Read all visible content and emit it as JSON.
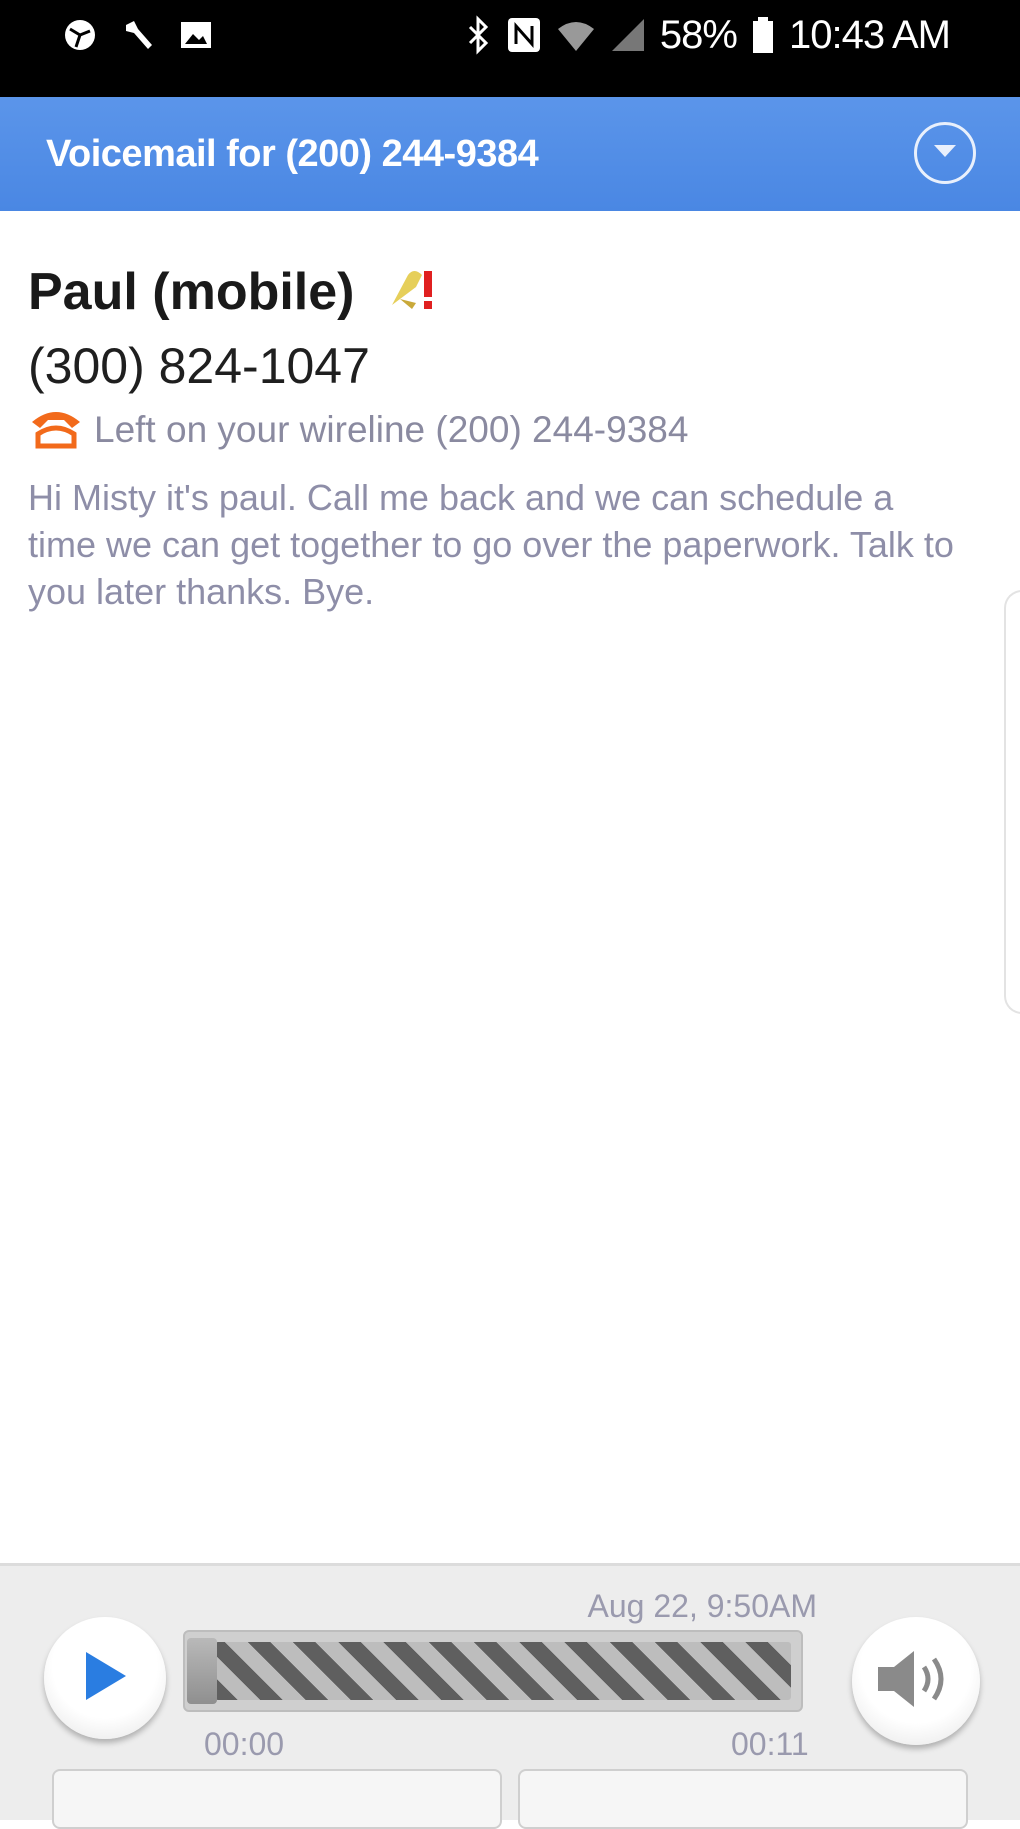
{
  "status_bar": {
    "battery": "58%",
    "time": "10:43 AM",
    "icons": [
      "vpn-icon",
      "wrench-icon",
      "image-icon",
      "bluetooth-icon",
      "nfc-icon",
      "wifi-icon",
      "signal-icon",
      "battery-icon"
    ]
  },
  "header": {
    "title": "Voicemail for (200) 244-9384",
    "menu_icon": "chevron-down-circle-icon",
    "color": "#4a87e3"
  },
  "message": {
    "contact_name": "Paul (mobile)",
    "priority_icon": "urgent-flag-icon",
    "phone_number": "(300) 824-1047",
    "line_icon": "phone-icon",
    "line_text": "Left on your wireline (200) 244-9384",
    "transcript": "Hi Misty it's paul. Call me back and we can schedule a time we can get together to go over the paperwork. Talk to you later thanks. Bye."
  },
  "player": {
    "timestamp": "Aug 22, 9:50AM",
    "time_start": "00:00",
    "time_end": "00:11",
    "progress": 0,
    "play_icon": "play-icon",
    "volume_icon": "speaker-icon",
    "accent": "#2a7de1"
  },
  "actions": {
    "callback_label": "",
    "delete_label": ""
  }
}
